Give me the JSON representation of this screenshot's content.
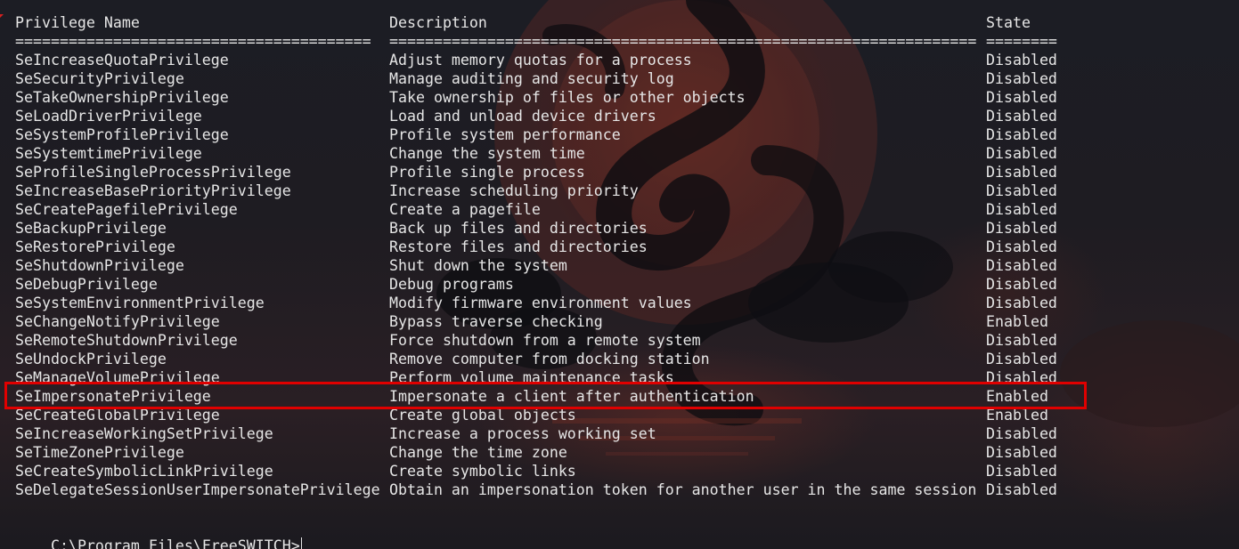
{
  "headers": {
    "name": "Privilege Name",
    "description": "Description",
    "state": "State"
  },
  "separators": {
    "name": "========================================",
    "description": "==================================================================",
    "state": "========"
  },
  "rows": [
    {
      "name": "SeIncreaseQuotaPrivilege",
      "description": "Adjust memory quotas for a process",
      "state": "Disabled"
    },
    {
      "name": "SeSecurityPrivilege",
      "description": "Manage auditing and security log",
      "state": "Disabled"
    },
    {
      "name": "SeTakeOwnershipPrivilege",
      "description": "Take ownership of files or other objects",
      "state": "Disabled"
    },
    {
      "name": "SeLoadDriverPrivilege",
      "description": "Load and unload device drivers",
      "state": "Disabled"
    },
    {
      "name": "SeSystemProfilePrivilege",
      "description": "Profile system performance",
      "state": "Disabled"
    },
    {
      "name": "SeSystemtimePrivilege",
      "description": "Change the system time",
      "state": "Disabled"
    },
    {
      "name": "SeProfileSingleProcessPrivilege",
      "description": "Profile single process",
      "state": "Disabled"
    },
    {
      "name": "SeIncreaseBasePriorityPrivilege",
      "description": "Increase scheduling priority",
      "state": "Disabled"
    },
    {
      "name": "SeCreatePagefilePrivilege",
      "description": "Create a pagefile",
      "state": "Disabled"
    },
    {
      "name": "SeBackupPrivilege",
      "description": "Back up files and directories",
      "state": "Disabled"
    },
    {
      "name": "SeRestorePrivilege",
      "description": "Restore files and directories",
      "state": "Disabled"
    },
    {
      "name": "SeShutdownPrivilege",
      "description": "Shut down the system",
      "state": "Disabled"
    },
    {
      "name": "SeDebugPrivilege",
      "description": "Debug programs",
      "state": "Disabled"
    },
    {
      "name": "SeSystemEnvironmentPrivilege",
      "description": "Modify firmware environment values",
      "state": "Disabled"
    },
    {
      "name": "SeChangeNotifyPrivilege",
      "description": "Bypass traverse checking",
      "state": "Enabled"
    },
    {
      "name": "SeRemoteShutdownPrivilege",
      "description": "Force shutdown from a remote system",
      "state": "Disabled"
    },
    {
      "name": "SeUndockPrivilege",
      "description": "Remove computer from docking station",
      "state": "Disabled"
    },
    {
      "name": "SeManageVolumePrivilege",
      "description": "Perform volume maintenance tasks",
      "state": "Disabled"
    },
    {
      "name": "SeImpersonatePrivilege",
      "description": "Impersonate a client after authentication",
      "state": "Enabled"
    },
    {
      "name": "SeCreateGlobalPrivilege",
      "description": "Create global objects",
      "state": "Enabled"
    },
    {
      "name": "SeIncreaseWorkingSetPrivilege",
      "description": "Increase a process working set",
      "state": "Disabled"
    },
    {
      "name": "SeTimeZonePrivilege",
      "description": "Change the time zone",
      "state": "Disabled"
    },
    {
      "name": "SeCreateSymbolicLinkPrivilege",
      "description": "Create symbolic links",
      "state": "Disabled"
    },
    {
      "name": "SeDelegateSessionUserImpersonatePrivilege",
      "description": "Obtain an impersonation token for another user in the same session",
      "state": "Disabled"
    }
  ],
  "prompt": "C:\\Program Files\\FreeSWITCH>",
  "highlight_color": "#e00000",
  "text_color": "#e6e6e6"
}
